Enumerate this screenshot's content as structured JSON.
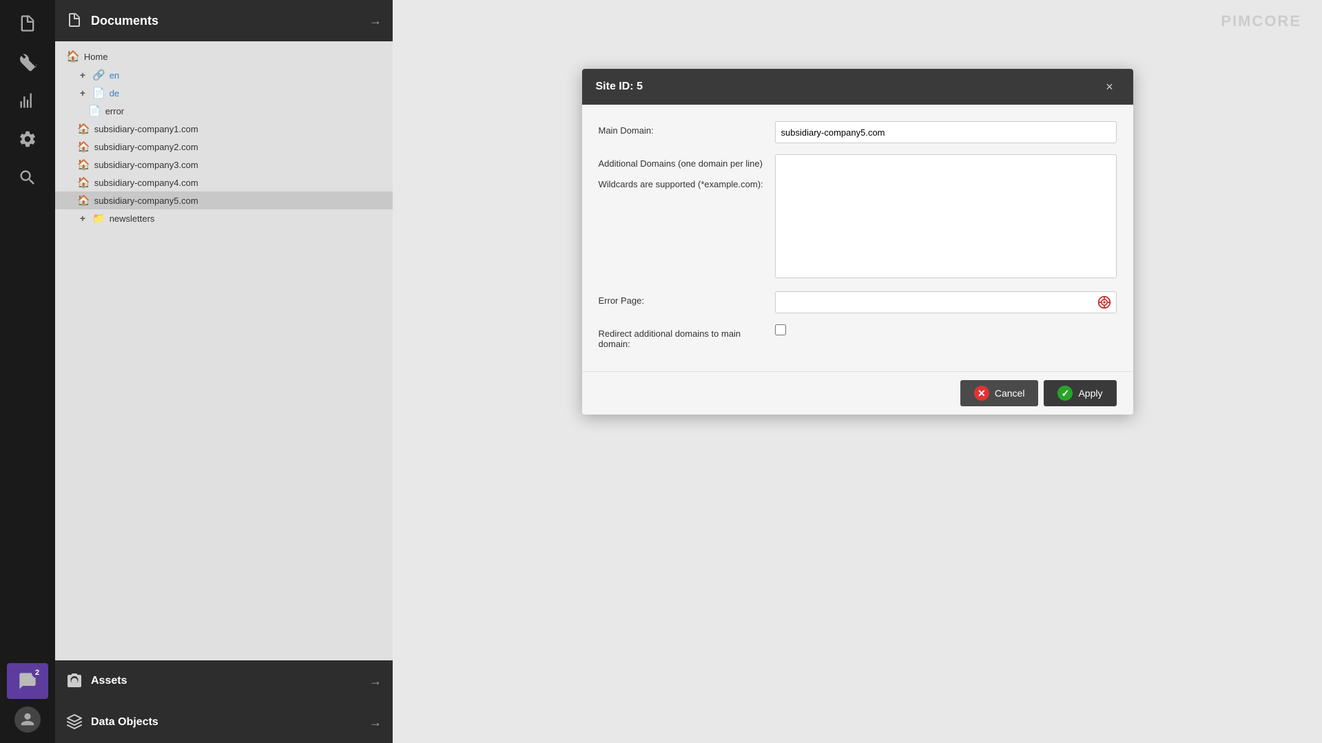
{
  "app": {
    "logo": "PIMCORE"
  },
  "sidebar": {
    "icons": [
      {
        "name": "document-icon",
        "symbol": "📄"
      },
      {
        "name": "wrench-icon",
        "symbol": "🔧"
      },
      {
        "name": "chart-icon",
        "symbol": "📊"
      },
      {
        "name": "settings-icon",
        "symbol": "⚙"
      },
      {
        "name": "search-icon",
        "symbol": "🔍"
      }
    ],
    "bottom_icons": [
      {
        "name": "chat-icon",
        "symbol": "💬",
        "badge": "2",
        "class": "chat-badge"
      },
      {
        "name": "user-icon",
        "symbol": "👤"
      }
    ]
  },
  "panel": {
    "title": "Documents",
    "tree": [
      {
        "indent": 0,
        "icon": "house",
        "label": "Home",
        "plus": false,
        "color": "normal"
      },
      {
        "indent": 1,
        "icon": "link",
        "label": "en",
        "plus": true,
        "color": "blue"
      },
      {
        "indent": 1,
        "icon": "page",
        "label": "de",
        "plus": true,
        "color": "blue"
      },
      {
        "indent": 2,
        "icon": "page",
        "label": "error",
        "plus": false,
        "color": "normal"
      },
      {
        "indent": 1,
        "icon": "house",
        "label": "subsidiary-company1.com",
        "plus": false,
        "color": "normal"
      },
      {
        "indent": 1,
        "icon": "house",
        "label": "subsidiary-company2.com",
        "plus": false,
        "color": "normal"
      },
      {
        "indent": 1,
        "icon": "house",
        "label": "subsidiary-company3.com",
        "plus": false,
        "color": "normal"
      },
      {
        "indent": 1,
        "icon": "house",
        "label": "subsidiary-company4.com",
        "plus": false,
        "color": "normal"
      },
      {
        "indent": 1,
        "icon": "house",
        "label": "subsidiary-company5.com",
        "plus": false,
        "color": "normal",
        "selected": true
      },
      {
        "indent": 1,
        "icon": "folder",
        "label": "newsletters",
        "plus": true,
        "color": "normal"
      }
    ]
  },
  "bottom_panels": [
    {
      "name": "assets",
      "icon": "camera",
      "label": "Assets"
    },
    {
      "name": "data-objects",
      "icon": "cube",
      "label": "Data Objects"
    }
  ],
  "modal": {
    "title": "Site ID: 5",
    "close_label": "×",
    "fields": {
      "main_domain_label": "Main Domain:",
      "main_domain_value": "subsidiary-company5.com",
      "additional_domains_label": "Additional Domains (one domain per line)\n\nWildcards are supported (*example.com):",
      "additional_domains_value": "",
      "error_page_label": "Error Page:",
      "error_page_value": "",
      "redirect_label": "Redirect additional domains to main domain:",
      "redirect_checked": false
    },
    "buttons": {
      "cancel_label": "Cancel",
      "apply_label": "Apply"
    }
  }
}
